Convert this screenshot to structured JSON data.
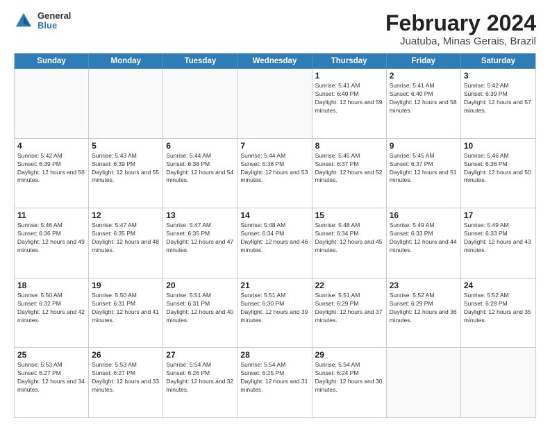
{
  "header": {
    "logo": {
      "general": "General",
      "blue": "Blue"
    },
    "title": "February 2024",
    "subtitle": "Juatuba, Minas Gerais, Brazil"
  },
  "calendar": {
    "days_of_week": [
      "Sunday",
      "Monday",
      "Tuesday",
      "Wednesday",
      "Thursday",
      "Friday",
      "Saturday"
    ],
    "weeks": [
      [
        {
          "day": "",
          "empty": true
        },
        {
          "day": "",
          "empty": true
        },
        {
          "day": "",
          "empty": true
        },
        {
          "day": "",
          "empty": true
        },
        {
          "day": "1",
          "sunrise": "Sunrise: 5:41 AM",
          "sunset": "Sunset: 6:40 PM",
          "daylight": "Daylight: 12 hours and 59 minutes."
        },
        {
          "day": "2",
          "sunrise": "Sunrise: 5:41 AM",
          "sunset": "Sunset: 6:40 PM",
          "daylight": "Daylight: 12 hours and 58 minutes."
        },
        {
          "day": "3",
          "sunrise": "Sunrise: 5:42 AM",
          "sunset": "Sunset: 6:39 PM",
          "daylight": "Daylight: 12 hours and 57 minutes."
        }
      ],
      [
        {
          "day": "4",
          "sunrise": "Sunrise: 5:42 AM",
          "sunset": "Sunset: 6:39 PM",
          "daylight": "Daylight: 12 hours and 56 minutes."
        },
        {
          "day": "5",
          "sunrise": "Sunrise: 5:43 AM",
          "sunset": "Sunset: 6:39 PM",
          "daylight": "Daylight: 12 hours and 55 minutes."
        },
        {
          "day": "6",
          "sunrise": "Sunrise: 5:44 AM",
          "sunset": "Sunset: 6:38 PM",
          "daylight": "Daylight: 12 hours and 54 minutes."
        },
        {
          "day": "7",
          "sunrise": "Sunrise: 5:44 AM",
          "sunset": "Sunset: 6:38 PM",
          "daylight": "Daylight: 12 hours and 53 minutes."
        },
        {
          "day": "8",
          "sunrise": "Sunrise: 5:45 AM",
          "sunset": "Sunset: 6:37 PM",
          "daylight": "Daylight: 12 hours and 52 minutes."
        },
        {
          "day": "9",
          "sunrise": "Sunrise: 5:45 AM",
          "sunset": "Sunset: 6:37 PM",
          "daylight": "Daylight: 12 hours and 51 minutes."
        },
        {
          "day": "10",
          "sunrise": "Sunrise: 5:46 AM",
          "sunset": "Sunset: 6:36 PM",
          "daylight": "Daylight: 12 hours and 50 minutes."
        }
      ],
      [
        {
          "day": "11",
          "sunrise": "Sunrise: 5:46 AM",
          "sunset": "Sunset: 6:36 PM",
          "daylight": "Daylight: 12 hours and 49 minutes."
        },
        {
          "day": "12",
          "sunrise": "Sunrise: 5:47 AM",
          "sunset": "Sunset: 6:35 PM",
          "daylight": "Daylight: 12 hours and 48 minutes."
        },
        {
          "day": "13",
          "sunrise": "Sunrise: 5:47 AM",
          "sunset": "Sunset: 6:35 PM",
          "daylight": "Daylight: 12 hours and 47 minutes."
        },
        {
          "day": "14",
          "sunrise": "Sunrise: 5:48 AM",
          "sunset": "Sunset: 6:34 PM",
          "daylight": "Daylight: 12 hours and 46 minutes."
        },
        {
          "day": "15",
          "sunrise": "Sunrise: 5:48 AM",
          "sunset": "Sunset: 6:34 PM",
          "daylight": "Daylight: 12 hours and 45 minutes."
        },
        {
          "day": "16",
          "sunrise": "Sunrise: 5:49 AM",
          "sunset": "Sunset: 6:33 PM",
          "daylight": "Daylight: 12 hours and 44 minutes."
        },
        {
          "day": "17",
          "sunrise": "Sunrise: 5:49 AM",
          "sunset": "Sunset: 6:33 PM",
          "daylight": "Daylight: 12 hours and 43 minutes."
        }
      ],
      [
        {
          "day": "18",
          "sunrise": "Sunrise: 5:50 AM",
          "sunset": "Sunset: 6:32 PM",
          "daylight": "Daylight: 12 hours and 42 minutes."
        },
        {
          "day": "19",
          "sunrise": "Sunrise: 5:50 AM",
          "sunset": "Sunset: 6:31 PM",
          "daylight": "Daylight: 12 hours and 41 minutes."
        },
        {
          "day": "20",
          "sunrise": "Sunrise: 5:51 AM",
          "sunset": "Sunset: 6:31 PM",
          "daylight": "Daylight: 12 hours and 40 minutes."
        },
        {
          "day": "21",
          "sunrise": "Sunrise: 5:51 AM",
          "sunset": "Sunset: 6:30 PM",
          "daylight": "Daylight: 12 hours and 39 minutes."
        },
        {
          "day": "22",
          "sunrise": "Sunrise: 5:51 AM",
          "sunset": "Sunset: 6:29 PM",
          "daylight": "Daylight: 12 hours and 37 minutes."
        },
        {
          "day": "23",
          "sunrise": "Sunrise: 5:52 AM",
          "sunset": "Sunset: 6:29 PM",
          "daylight": "Daylight: 12 hours and 36 minutes."
        },
        {
          "day": "24",
          "sunrise": "Sunrise: 5:52 AM",
          "sunset": "Sunset: 6:28 PM",
          "daylight": "Daylight: 12 hours and 35 minutes."
        }
      ],
      [
        {
          "day": "25",
          "sunrise": "Sunrise: 5:53 AM",
          "sunset": "Sunset: 6:27 PM",
          "daylight": "Daylight: 12 hours and 34 minutes."
        },
        {
          "day": "26",
          "sunrise": "Sunrise: 5:53 AM",
          "sunset": "Sunset: 6:27 PM",
          "daylight": "Daylight: 12 hours and 33 minutes."
        },
        {
          "day": "27",
          "sunrise": "Sunrise: 5:54 AM",
          "sunset": "Sunset: 6:26 PM",
          "daylight": "Daylight: 12 hours and 32 minutes."
        },
        {
          "day": "28",
          "sunrise": "Sunrise: 5:54 AM",
          "sunset": "Sunset: 6:25 PM",
          "daylight": "Daylight: 12 hours and 31 minutes."
        },
        {
          "day": "29",
          "sunrise": "Sunrise: 5:54 AM",
          "sunset": "Sunset: 6:24 PM",
          "daylight": "Daylight: 12 hours and 30 minutes."
        },
        {
          "day": "",
          "empty": true
        },
        {
          "day": "",
          "empty": true
        }
      ]
    ]
  }
}
